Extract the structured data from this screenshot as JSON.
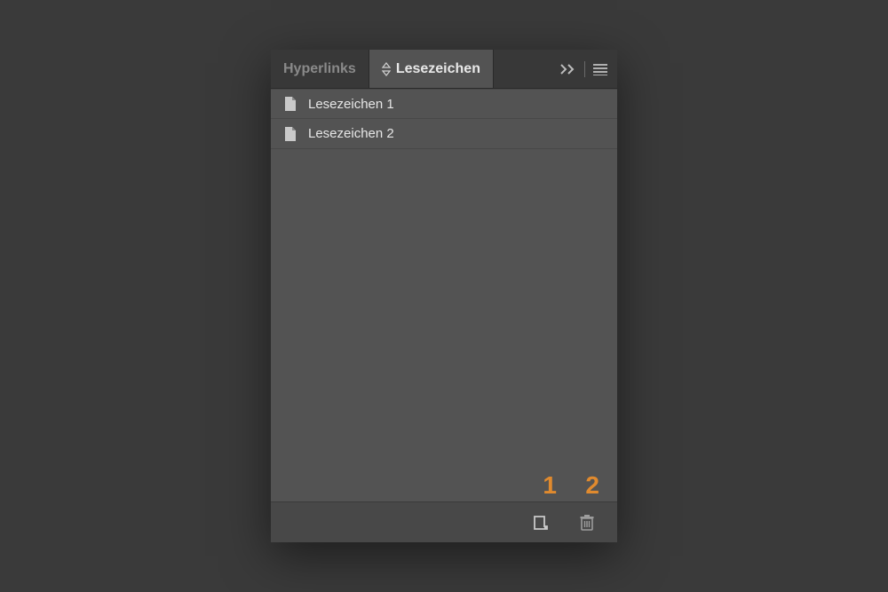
{
  "tabs": {
    "hyperlinks": {
      "label": "Hyperlinks"
    },
    "bookmarks": {
      "label": "Lesezeichen"
    }
  },
  "bookmarks": {
    "items": [
      {
        "label": "Lesezeichen 1"
      },
      {
        "label": "Lesezeichen 2"
      }
    ]
  },
  "annotations": {
    "new_bookmark": "1",
    "delete_bookmark": "2"
  },
  "colors": {
    "annotation": "#e08a2e",
    "panel_bg": "#535353",
    "panel_header": "#383838"
  }
}
